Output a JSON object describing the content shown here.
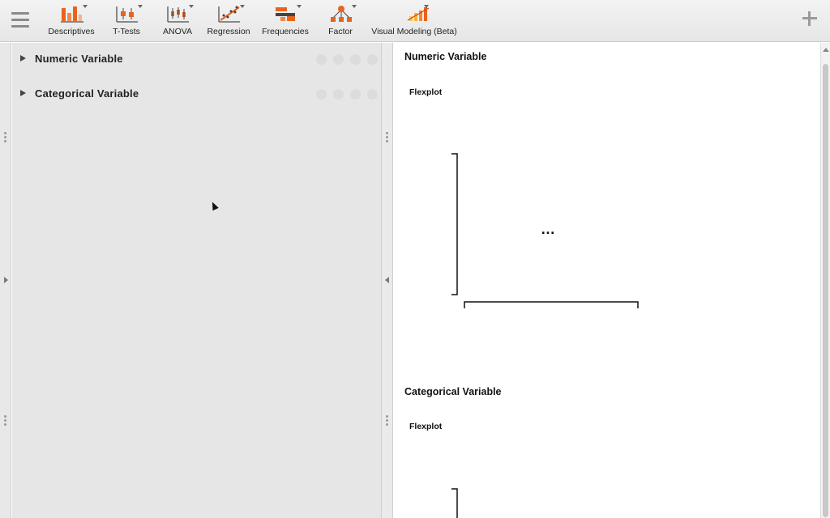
{
  "toolbar": {
    "items": [
      {
        "label": "Descriptives",
        "icon": "descriptives-icon"
      },
      {
        "label": "T-Tests",
        "icon": "t-tests-icon"
      },
      {
        "label": "ANOVA",
        "icon": "anova-icon"
      },
      {
        "label": "Regression",
        "icon": "regression-icon"
      },
      {
        "label": "Frequencies",
        "icon": "frequencies-icon"
      },
      {
        "label": "Factor",
        "icon": "factor-icon"
      },
      {
        "label": "Visual Modeling (Beta)",
        "icon": "visual-modeling-icon"
      }
    ],
    "accent_color": "#e8641e"
  },
  "analyses": [
    {
      "title": "Numeric Variable"
    },
    {
      "title": "Categorical Variable"
    }
  ],
  "results": [
    {
      "heading": "Numeric Variable",
      "plot_title": "Flexplot",
      "loading_text": "…"
    },
    {
      "heading": "Categorical Variable",
      "plot_title": "Flexplot"
    }
  ]
}
